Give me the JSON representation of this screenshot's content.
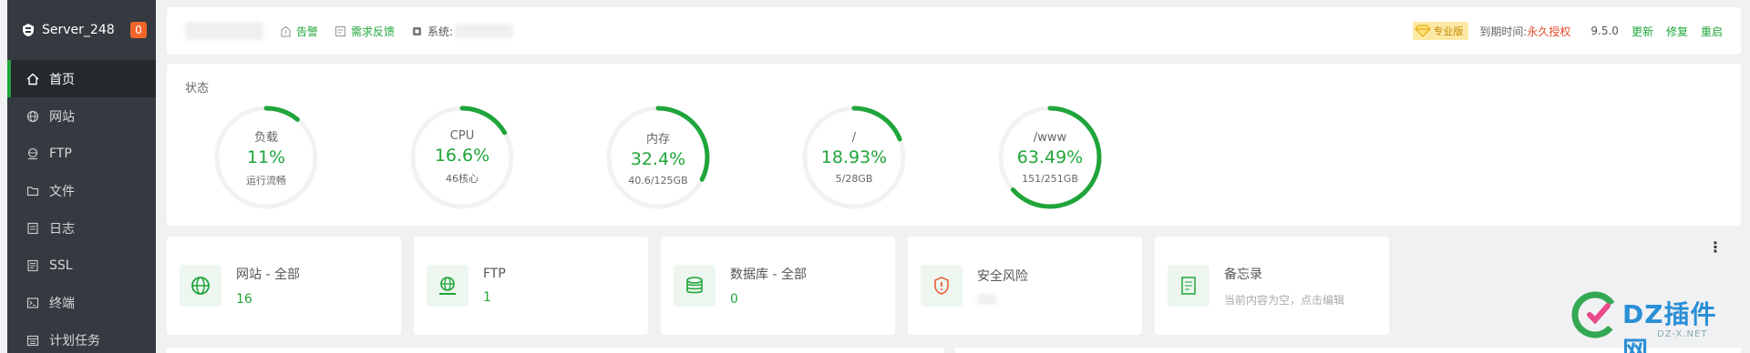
{
  "sidebar": {
    "server_name": "Server_248",
    "alert_count": "0",
    "items": [
      {
        "label": "首页",
        "icon": "home-icon",
        "active": true
      },
      {
        "label": "网站",
        "icon": "globe-icon"
      },
      {
        "label": "FTP",
        "icon": "ftp-icon"
      },
      {
        "label": "文件",
        "icon": "folder-icon"
      },
      {
        "label": "日志",
        "icon": "log-icon"
      },
      {
        "label": "SSL",
        "icon": "ssl-icon"
      },
      {
        "label": "终端",
        "icon": "terminal-icon"
      },
      {
        "label": "计划任务",
        "icon": "schedule-icon"
      }
    ]
  },
  "topbar": {
    "alert_label": "告警",
    "feedback_label": "需求反馈",
    "system_label": "系统:",
    "pro_label": "专业版",
    "expire_label": "到期时间:",
    "expire_value": "永久授权",
    "version": "9.5.0",
    "update_label": "更新",
    "repair_label": "修复",
    "restart_label": "重启"
  },
  "status": {
    "title": "状态",
    "gauges": [
      {
        "label": "负载",
        "value": "11%",
        "sub": "运行流畅",
        "percent": 11
      },
      {
        "label": "CPU",
        "value": "16.6%",
        "sub": "46核心",
        "percent": 16.6
      },
      {
        "label": "内存",
        "value": "32.4%",
        "sub": "40.6/125GB",
        "percent": 32.4
      },
      {
        "label": "/",
        "value": "18.93%",
        "sub": "5/28GB",
        "percent": 18.93
      },
      {
        "label": "/www",
        "value": "63.49%",
        "sub": "151/251GB",
        "percent": 63.49
      }
    ]
  },
  "cards": [
    {
      "title": "网站 - 全部",
      "value": "16",
      "icon": "globe-icon"
    },
    {
      "title": "FTP",
      "value": "1",
      "icon": "ftp-icon"
    },
    {
      "title": "数据库 - 全部",
      "value": "0",
      "icon": "database-icon"
    },
    {
      "title": "安全风险",
      "value": "",
      "icon": "shield-alert-icon"
    },
    {
      "title": "备忘录",
      "hint": "当前内容为空，点击编辑",
      "icon": "memo-icon"
    }
  ],
  "watermark": {
    "brand": "DZ插件网",
    "url": "DZ-X.NET"
  },
  "colors": {
    "accent": "#20a53a",
    "sidebar_bg": "#343a40",
    "badge": "#f0662a",
    "expire": "#e44c2c",
    "gauge_track": "#f2f2f2"
  }
}
